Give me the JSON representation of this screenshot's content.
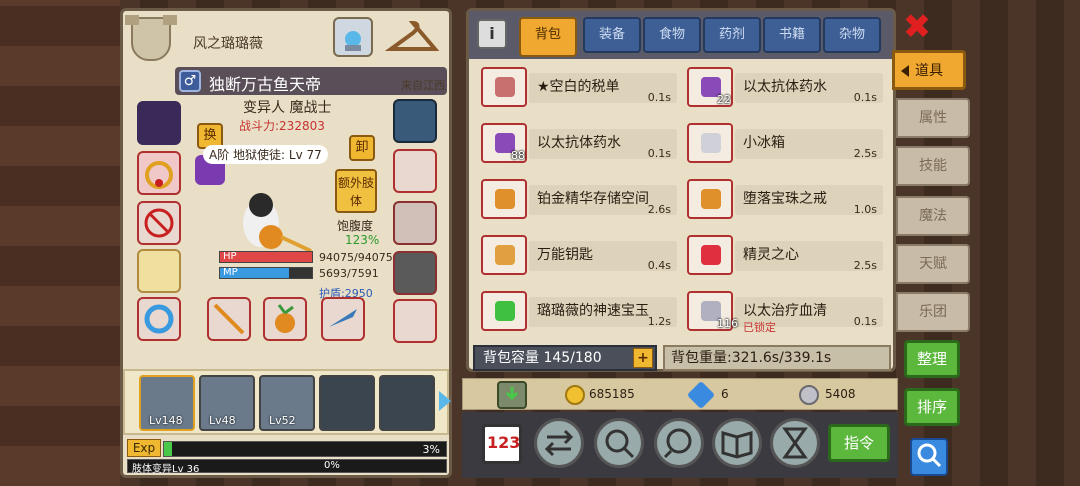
{
  "character": {
    "player_name": "风之璐璐薇",
    "title": "独断万古鱼天帝",
    "from": "来自江西",
    "class": "变异人 魔战士",
    "power": "战斗力:232803",
    "stage": "A阶 地狱使徒: Lv 77",
    "swap_label": "换",
    "unequip_label": "卸",
    "extra_limb_label": "额外肢体",
    "satiety_label": "饱腹度",
    "satiety_value": "123%",
    "hp_label": "HP",
    "hp_value": "94075/94075",
    "hp_fraction": 1.0,
    "mp_label": "MP",
    "mp_value": "5693/7591",
    "mp_fraction": 0.75,
    "shield": "护盾:2950",
    "gender_icon": "male-icon"
  },
  "companions": [
    {
      "level": "Lv148"
    },
    {
      "level": "Lv48"
    },
    {
      "level": "Lv52"
    }
  ],
  "exp": {
    "label": "Exp",
    "percent": "3%",
    "fraction": 0.03,
    "mutation_label": "肢体变异Lv 36",
    "mutation_percent": "0%"
  },
  "inventory": {
    "tabs": [
      "背包",
      "装备",
      "食物",
      "药剂",
      "书籍",
      "杂物"
    ],
    "active_tab": "背包",
    "items": [
      {
        "name": "★空白的税单",
        "time": "0.1s",
        "count": "",
        "locked": "",
        "icon": "tax-form-icon",
        "color": "#c87070"
      },
      {
        "name": "以太抗体药水",
        "time": "0.1s",
        "count": "22",
        "locked": "",
        "icon": "potion-icon",
        "color": "#8a4ab8"
      },
      {
        "name": "以太抗体药水",
        "time": "0.1s",
        "count": "88",
        "locked": "",
        "icon": "potion-icon",
        "color": "#8a4ab8"
      },
      {
        "name": "小冰箱",
        "time": "2.5s",
        "count": "",
        "locked": "",
        "icon": "fridge-icon",
        "color": "#d0d0d8"
      },
      {
        "name": "铂金精华存储空间",
        "time": "2.6s",
        "count": "",
        "locked": "",
        "icon": "ring-icon",
        "color": "#e0902a"
      },
      {
        "name": "堕落宝珠之戒",
        "time": "1.0s",
        "count": "",
        "locked": "",
        "icon": "orb-ring-icon",
        "color": "#e0902a"
      },
      {
        "name": "万能钥匙",
        "time": "0.4s",
        "count": "",
        "locked": "",
        "icon": "key-icon",
        "color": "#e0a040"
      },
      {
        "name": "精灵之心",
        "time": "2.5s",
        "count": "",
        "locked": "",
        "icon": "heart-icon",
        "color": "#e03040"
      },
      {
        "name": "璐璐薇的神速宝玉",
        "time": "1.2s",
        "count": "",
        "locked": "",
        "icon": "gem-icon",
        "color": "#40c040"
      },
      {
        "name": "以太治疗血清",
        "time": "0.1s",
        "count": "116",
        "locked": "已锁定",
        "icon": "syringe-icon",
        "color": "#b0b0c0"
      }
    ],
    "capacity": "背包容量 145/180",
    "weight": "背包重量:321.6s/339.1s"
  },
  "currency": {
    "gold": "685185",
    "diamond": "6",
    "silver": "5408"
  },
  "actions": {
    "command_label": "指令",
    "counter_label": "123"
  },
  "side_tabs": [
    "道具",
    "属性",
    "技能",
    "魔法",
    "天赋",
    "乐团"
  ],
  "side_buttons": {
    "organize": "整理",
    "sort": "排序"
  },
  "colors": {
    "panel_bg": "#e9dfc6",
    "tab_active": "#f0a830",
    "tab_inactive": "#3d5f95",
    "green_btn": "#5cb83c",
    "danger": "#c83232"
  }
}
